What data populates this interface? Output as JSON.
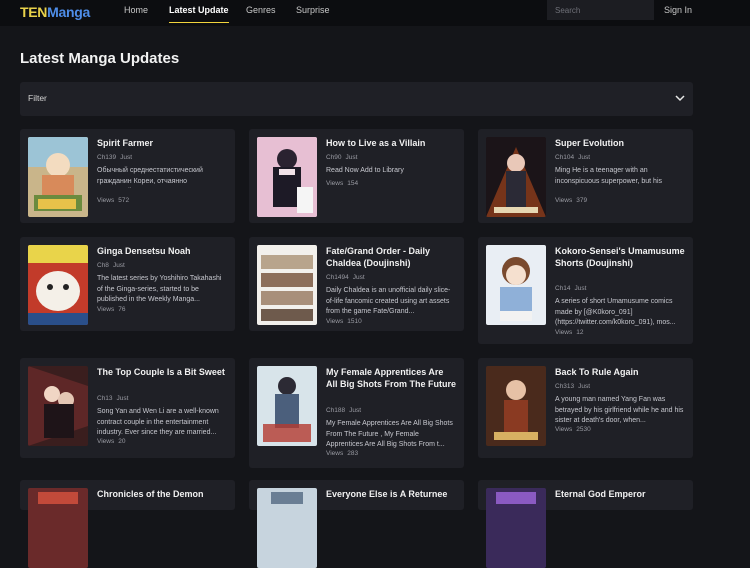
{
  "header": {
    "logo_part1": "TEN",
    "logo_part2": "Manga",
    "nav": [
      {
        "label": "Home"
      },
      {
        "label": "Latest Update"
      },
      {
        "label": "Genres"
      },
      {
        "label": "Surprise"
      }
    ],
    "search_placeholder": "Search",
    "signin_label": "Sign In"
  },
  "page_title": "Latest Manga Updates",
  "filter": {
    "label": "Filter",
    "icon": "chevron-down-icon"
  },
  "views_label": "Views",
  "cards": [
    {
      "title": "Spirit Farmer",
      "chapter": "Ch139",
      "time": "Just",
      "desc": "Обычный среднестатистический гражданин Кореи, отчаянно пытающийся стать героем на...",
      "views": "572"
    },
    {
      "title": "How to Live as a Villain",
      "chapter": "Ch90",
      "time": "Just",
      "desc": "Read Now Add to Library",
      "views": "154"
    },
    {
      "title": "Super Evolution",
      "chapter": "Ch104",
      "time": "Just",
      "desc": "Ming He is a teenager with an inconspicuous superpower, but his superpower is the lowest one out of t...",
      "views": "379"
    },
    {
      "title": "Ginga Densetsu Noah",
      "chapter": "Ch8",
      "time": "Just",
      "desc": "The latest series by Yoshihiro Takahashi of the Ginga-series, started to be published in the Weekly Manga...",
      "views": "76"
    },
    {
      "title": "Fate/Grand Order - Daily Chaldea (Doujinshi)",
      "chapter": "Ch1494",
      "time": "Just",
      "desc": "Daily Chaldea is an unofficial daily slice-of-life fancomic created using art assets from the game Fate/Grand...",
      "views": "1510"
    },
    {
      "title": "Kokoro-Sensei's Umamusume Shorts (Doujinshi)",
      "chapter": "Ch14",
      "time": "Just",
      "desc": "A series of short Umamusume comics made by [@K0koro_091] (https://twitter.com/k0koro_091), mos...",
      "views": "12"
    },
    {
      "title": "The Top Couple Is a Bit Sweet",
      "chapter": "Ch13",
      "time": "Just",
      "desc": "Song Yan and Wen Li are a well-known contract couple in the entertainment industry. Ever since they are married...",
      "views": "20"
    },
    {
      "title": "My Female Apprentices Are All Big Shots From The Future",
      "chapter": "Ch188",
      "time": "Just",
      "desc": "My Female Apprentices Are All Big Shots From The Future , My Female Apprentices Are All Big Shots From t...",
      "views": "283"
    },
    {
      "title": "Back To Rule Again",
      "chapter": "Ch313",
      "time": "Just",
      "desc": "A young man named Yang Fan was betrayed by his girlfriend while he and his sister at death's door, when...",
      "views": "2530"
    },
    {
      "title": "Chronicles of the Demon",
      "chapter": "",
      "time": "",
      "desc": "",
      "views": ""
    },
    {
      "title": "Everyone Else is A Returnee",
      "chapter": "",
      "time": "",
      "desc": "",
      "views": ""
    },
    {
      "title": "Eternal God Emperor",
      "chapter": "",
      "time": "",
      "desc": "",
      "views": ""
    }
  ]
}
